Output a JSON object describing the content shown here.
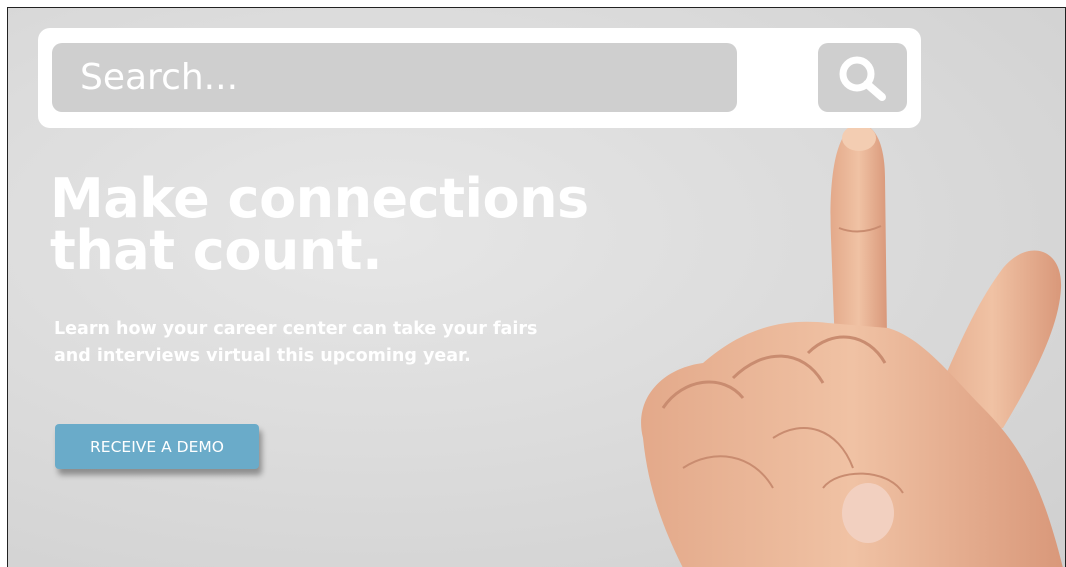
{
  "search": {
    "placeholder": "Search...",
    "button_icon": "search-icon"
  },
  "hero": {
    "headline_line1": "Make connections",
    "headline_line2": "that count.",
    "subtext_line1": "Learn how your career center can take your fairs",
    "subtext_line2": "and interviews virtual this upcoming year.",
    "cta_label": "RECEIVE A DEMO"
  },
  "colors": {
    "background": "#dcdcdc",
    "cta": "#6aabc9",
    "search_field": "#cfcfcf",
    "text": "#ffffff"
  }
}
